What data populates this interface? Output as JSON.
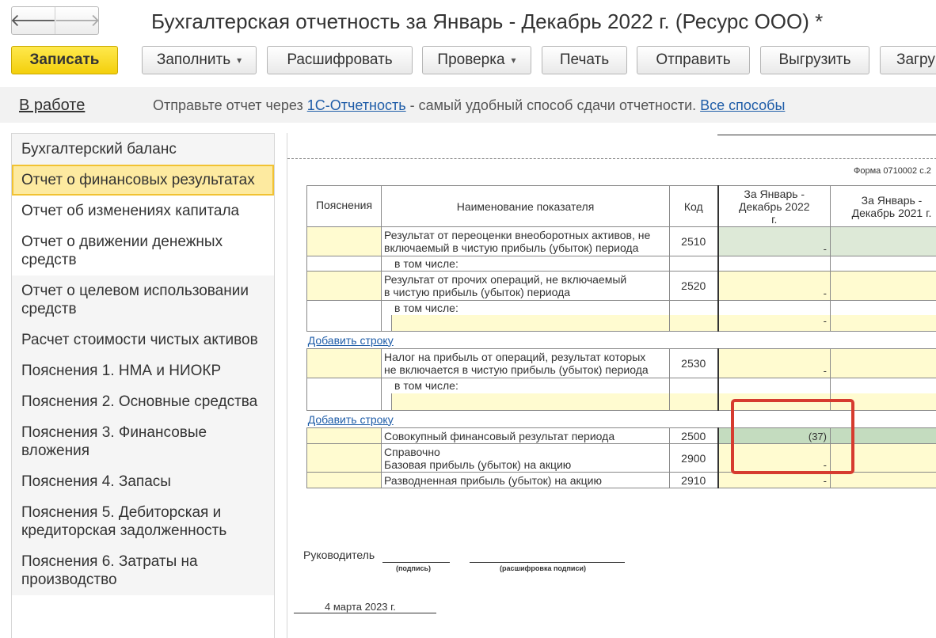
{
  "window": {
    "title": "Бухгалтерская отчетность за Январь - Декабрь 2022 г. (Ресурс ООО) *",
    "back_icon": "arrow-left-icon",
    "forward_icon": "arrow-right-icon"
  },
  "toolbar": {
    "save": "Записать",
    "fill": "Заполнить",
    "decode": "Расшифровать",
    "check": "Проверка",
    "print": "Печать",
    "send": "Отправить",
    "export": "Выгрузить",
    "import": "Загру",
    "dropdown_glyph": "▾"
  },
  "infobar": {
    "status": "В работе",
    "text_before": "Отправьте отчет через ",
    "link_1c": "1С-Отчетность",
    "text_after": " - самый удобный способ сдачи отчетности. ",
    "link_all": "Все способы"
  },
  "sidebar": {
    "items": [
      {
        "label": "Бухгалтерский баланс"
      },
      {
        "label": "Отчет о финансовых результатах"
      },
      {
        "label": "Отчет об изменениях капитала"
      },
      {
        "label": "Отчет о движении денежных средств"
      },
      {
        "label": "Отчет о целевом использовании средств"
      },
      {
        "label": "Расчет стоимости чистых активов"
      },
      {
        "label": "Пояснения 1. НМА и НИОКР"
      },
      {
        "label": "Пояснения 2. Основные средства"
      },
      {
        "label": "Пояснения 3. Финансовые вложения"
      },
      {
        "label": "Пояснения 4. Запасы"
      },
      {
        "label": "Пояснения 5. Дебиторская и кредиторская задолженность"
      },
      {
        "label": "Пояснения 6. Затраты на производство"
      }
    ],
    "selected_index": 1
  },
  "report": {
    "form_code": "Форма 0710002 с.2",
    "headers": {
      "notes": "Пояснения",
      "name": "Наименование показателя",
      "code": "Код",
      "current": "За Январь - Декабрь 2022 г.",
      "previous": "За Январь - Декабрь 2021 г."
    },
    "rows": {
      "r2510_name_1": "Результат от переоценки внеоборотных активов, не",
      "r2510_name_2": "включаемый в чистую прибыль (убыток) периода",
      "r2510_code": "2510",
      "r2510_val": "-",
      "incl_1": "в том числе:",
      "r2520_name_1": "Результат от прочих операций, не включаемый",
      "r2520_name_2": "в чистую прибыль (убыток) периода",
      "r2520_code": "2520",
      "r2520_val": "-",
      "incl_2": "в том числе:",
      "incl_2_val": "-",
      "add_row_1": "Добавить строку",
      "r2530_name_1": "Налог на прибыль от операций, результат которых",
      "r2530_name_2": "не включается в чистую прибыль (убыток) периода",
      "r2530_code": "2530",
      "r2530_val": "-",
      "incl_3": "в том числе:",
      "incl_3_val": "-",
      "add_row_2": "Добавить строку",
      "r2500_name": "Совокупный финансовый результат периода",
      "r2500_code": "2500",
      "r2500_val": "(37)",
      "r2900_name_1": "Справочно",
      "r2900_name_2": "Базовая прибыль (убыток) на акцию",
      "r2900_code": "2900",
      "r2900_val": "-",
      "r2910_name": "Разводненная прибыль (убыток) на акцию",
      "r2910_code": "2910",
      "r2910_val": "-",
      "add_plus": "+"
    }
  },
  "signature": {
    "head_label": "Руководитель",
    "sign_caption": "(подпись)",
    "decode_caption": "(расшифровка подписи)",
    "date": "4 марта 2023 г."
  }
}
